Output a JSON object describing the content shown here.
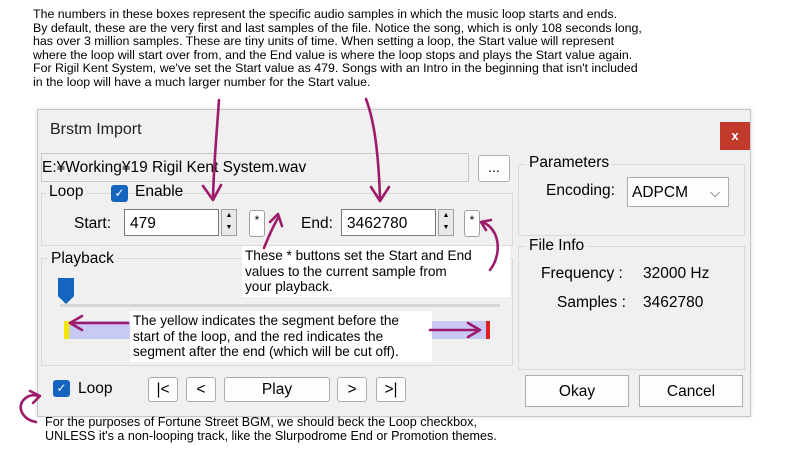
{
  "intro_text": "The numbers in these boxes represent the specific audio samples in which the music loop starts and ends.\nBy default, these are the very first and last samples of the file. Notice the song, which is only 108 seconds long,\nhas over 3 million samples. These are tiny units of time. When setting a loop, the Start value will represent\nwhere the loop will start over from, and the End value is where the loop stops and plays the Start value again.\nFor Rigil Kent System, we've set the Start value as 479. Songs with an Intro in the beginning that isn't included\nin the loop will have a much larger number for the Start value.",
  "window": {
    "title": "Brstm Import",
    "close_label": "x",
    "file_path": "E:¥Working¥19 Rigil Kent System.wav",
    "browse_label": "...",
    "loop_group": {
      "label": "Loop",
      "enable_label": "Enable",
      "enable_checked": true,
      "start_label": "Start:",
      "start_value": "479",
      "end_label": "End:",
      "end_value": "3462780",
      "star_label": "*"
    },
    "playback_group": {
      "label": "Playback"
    },
    "bottom": {
      "loop_label": "Loop",
      "loop_checked": true,
      "first_label": "|<",
      "prev_label": "<",
      "play_label": "Play",
      "next_label": ">",
      "last_label": ">|"
    },
    "parameters": {
      "label": "Parameters",
      "encoding_label": "Encoding:",
      "encoding_value": "ADPCM"
    },
    "file_info": {
      "label": "File Info",
      "frequency_label": "Frequency :",
      "frequency_value": "32000 Hz",
      "samples_label": "Samples :",
      "samples_value": "3462780"
    },
    "okay_label": "Okay",
    "cancel_label": "Cancel"
  },
  "annotations": {
    "star_note": "These * buttons set the Start and End\nvalues to the current sample from\nyour playback.",
    "segment_note": "The yellow indicates the segment before the\nstart of the loop, and the red indicates the\nsegment after the end (which will be cut off).",
    "footer_note": "For the purposes of Fortune Street BGM, we should beck the Loop checkbox,\nUNLESS it's a non-looping track, like the Slurpodrome End or Promotion themes."
  },
  "colors": {
    "checkbox_blue": "#1565c0",
    "arrow_magenta": "#9c1c6b",
    "loop_region": "#c9c9f5",
    "pre_loop": "#f5e600",
    "post_loop": "#e02020",
    "close_red": "#c0392b"
  },
  "icons": {
    "checkbox_check": "check-icon",
    "spinner": "spinner-arrows-icon",
    "dropdown": "chevron-down-icon"
  }
}
